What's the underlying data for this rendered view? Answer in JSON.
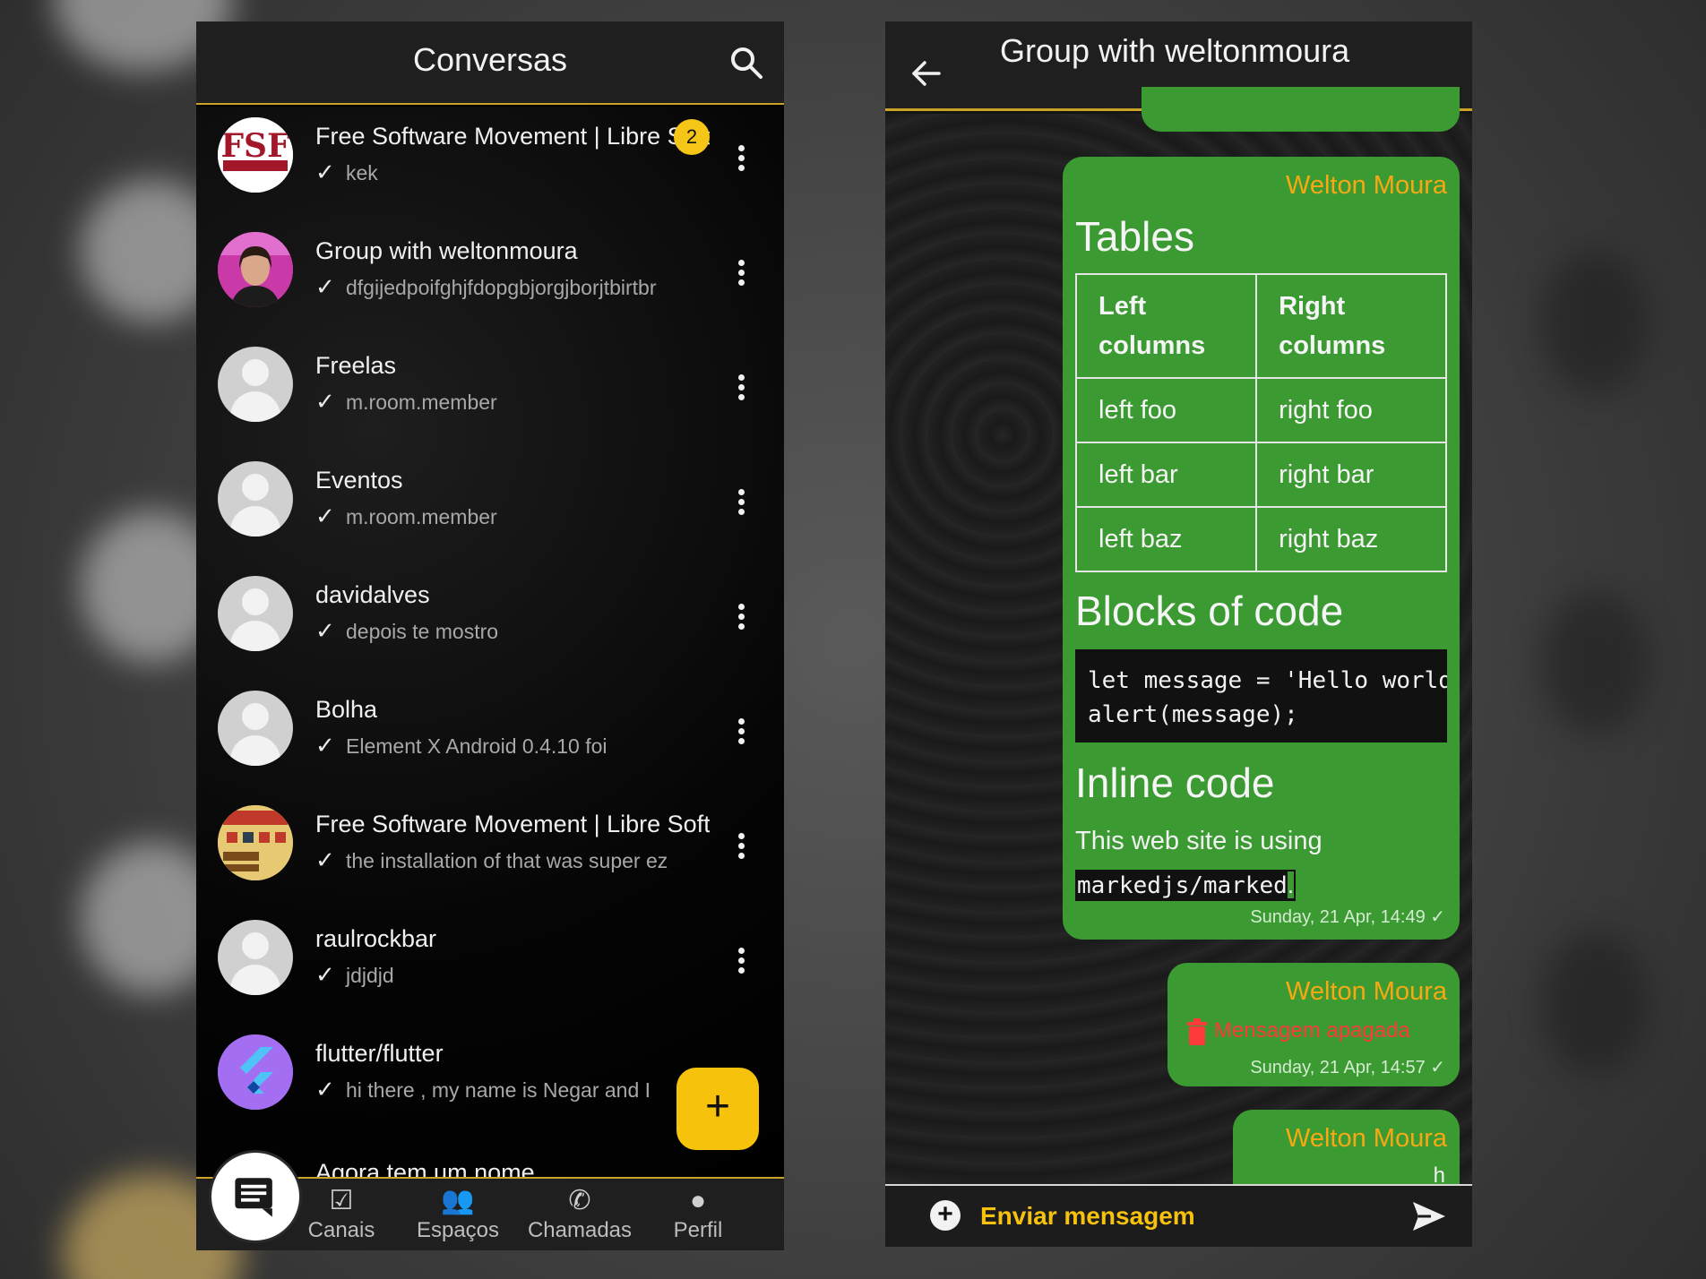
{
  "left": {
    "header_title": "Conversas",
    "conversations": [
      {
        "name": "Free Software Movement | Libre Soft",
        "last": "kek",
        "badge": "2"
      },
      {
        "name": "Group with weltonmoura",
        "last": "dfgijedpoifghjfdopgbjorgjborjtbirtbr"
      },
      {
        "name": "Freelas",
        "last": "m.room.member"
      },
      {
        "name": "Eventos",
        "last": "m.room.member"
      },
      {
        "name": "davidalves",
        "last": "depois te mostro"
      },
      {
        "name": "Bolha",
        "last": "Element X Android 0.4.10 foi"
      },
      {
        "name": "Free Software Movement | Libre Soft",
        "last": "the installation of that was super ez"
      },
      {
        "name": "raulrockbar",
        "last": "jdjdjd"
      },
      {
        "name": "flutter/flutter",
        "last": "hi there , my name is Negar and I"
      }
    ],
    "partial_item": "Agora tem um nome",
    "fab_label": "+",
    "nav": [
      {
        "label": "Canais",
        "icon": "channels-icon"
      },
      {
        "label": "Espaços",
        "icon": "spaces-icon"
      },
      {
        "label": "Chamadas",
        "icon": "phone-icon"
      },
      {
        "label": "Perfil",
        "icon": "person-icon"
      }
    ]
  },
  "right": {
    "header_title": "Group with weltonmoura",
    "messages": [
      {
        "sender": "Welton Moura",
        "heading_tables": "Tables",
        "table": {
          "headers": [
            "Left columns",
            "Right columns"
          ],
          "rows": [
            [
              "left foo",
              "right foo"
            ],
            [
              "left bar",
              "right bar"
            ],
            [
              "left baz",
              "right baz"
            ]
          ]
        },
        "heading_code": "Blocks of code",
        "code": "let message = 'Hello world';\nalert(message);",
        "heading_inline": "Inline code",
        "paragraph": "This web site is using",
        "inline_code": "markedjs/marked",
        "trailing": ".",
        "timestamp": "Sunday, 21 Apr, 14:49 ✓"
      },
      {
        "sender": "Welton Moura",
        "deleted_text": "Mensagem apagada",
        "timestamp": "Sunday, 21 Apr, 14:57 ✓"
      },
      {
        "sender": "Welton Moura",
        "partial": "h"
      }
    ],
    "composer_placeholder": "Enviar mensagem"
  },
  "colors": {
    "accent": "#f7c20c",
    "bubble": "#3b9a32",
    "sender": "#f7a812",
    "deleted": "#ff3a3a"
  }
}
